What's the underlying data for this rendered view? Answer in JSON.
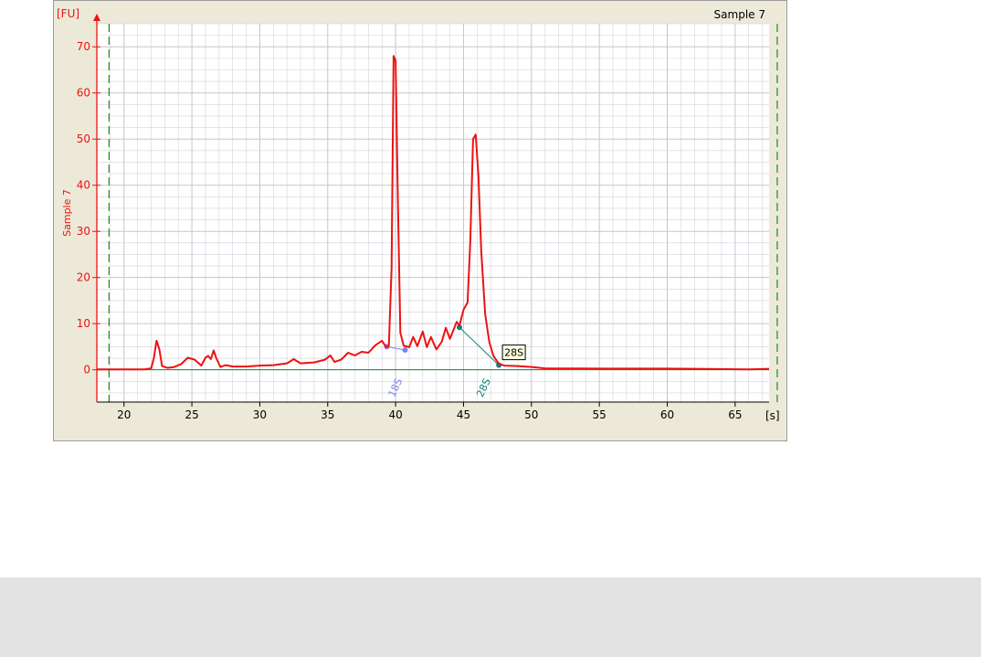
{
  "chart_data": {
    "type": "line",
    "title": "Sample 7",
    "ylabel": "Sample 7",
    "y_unit": "[FU]",
    "x_unit": "[s]",
    "xlim": [
      18,
      67.5
    ],
    "ylim": [
      -7,
      75
    ],
    "x_ticks": [
      20,
      25,
      30,
      35,
      40,
      45,
      50,
      55,
      60,
      65
    ],
    "y_ticks": [
      0,
      10,
      20,
      30,
      40,
      50,
      60,
      70
    ],
    "grid": true,
    "colors": {
      "trace": "#ee1111",
      "baseline": "#1e8a1e",
      "markers": "#1e8a1e",
      "axis": "#ee1111",
      "grid": "#c6c6d2",
      "plot_bg": "#ffffff",
      "peak_18s": "#8080ee",
      "peak_28s": "#138080"
    },
    "vertical_markers": [
      18.9,
      68.1
    ],
    "series": [
      {
        "name": "Sample 7",
        "points": [
          [
            18,
            0.1
          ],
          [
            20,
            0.1
          ],
          [
            21.5,
            0.1
          ],
          [
            22,
            0.3
          ],
          [
            22.2,
            2.5
          ],
          [
            22.4,
            6.3
          ],
          [
            22.6,
            4.5
          ],
          [
            22.8,
            0.8
          ],
          [
            23.2,
            0.4
          ],
          [
            23.7,
            0.6
          ],
          [
            24.2,
            1.2
          ],
          [
            24.7,
            2.6
          ],
          [
            25.2,
            2.2
          ],
          [
            25.7,
            0.9
          ],
          [
            26.0,
            2.6
          ],
          [
            26.2,
            3.0
          ],
          [
            26.4,
            2.3
          ],
          [
            26.6,
            4.2
          ],
          [
            26.8,
            2.5
          ],
          [
            27.1,
            0.6
          ],
          [
            27.5,
            1.0
          ],
          [
            28,
            0.7
          ],
          [
            29,
            0.7
          ],
          [
            30,
            0.9
          ],
          [
            31,
            1.0
          ],
          [
            32,
            1.4
          ],
          [
            32.5,
            2.3
          ],
          [
            33,
            1.4
          ],
          [
            34,
            1.6
          ],
          [
            34.8,
            2.2
          ],
          [
            35.2,
            3.1
          ],
          [
            35.5,
            1.7
          ],
          [
            36,
            2.2
          ],
          [
            36.5,
            3.7
          ],
          [
            37,
            3.1
          ],
          [
            37.5,
            3.9
          ],
          [
            38,
            3.7
          ],
          [
            38.5,
            5.3
          ],
          [
            39,
            6.3
          ],
          [
            39.3,
            4.9
          ],
          [
            39.5,
            5.1
          ],
          [
            39.7,
            22
          ],
          [
            39.85,
            68
          ],
          [
            40.0,
            67
          ],
          [
            40.15,
            40
          ],
          [
            40.35,
            8
          ],
          [
            40.6,
            5.2
          ],
          [
            41,
            4.9
          ],
          [
            41.3,
            7.1
          ],
          [
            41.6,
            5.1
          ],
          [
            42,
            8.3
          ],
          [
            42.3,
            4.9
          ],
          [
            42.6,
            7.1
          ],
          [
            43,
            4.4
          ],
          [
            43.4,
            6.1
          ],
          [
            43.7,
            9.1
          ],
          [
            44,
            6.7
          ],
          [
            44.3,
            8.9
          ],
          [
            44.5,
            10.4
          ],
          [
            44.7,
            9.6
          ],
          [
            45,
            13
          ],
          [
            45.3,
            14.6
          ],
          [
            45.5,
            28
          ],
          [
            45.7,
            50
          ],
          [
            45.9,
            51
          ],
          [
            46.1,
            42
          ],
          [
            46.3,
            26
          ],
          [
            46.6,
            12
          ],
          [
            46.9,
            6
          ],
          [
            47.2,
            3
          ],
          [
            47.6,
            1.3
          ],
          [
            48,
            0.9
          ],
          [
            49,
            0.8
          ],
          [
            50,
            0.6
          ],
          [
            51,
            0.3
          ],
          [
            55,
            0.25
          ],
          [
            60,
            0.25
          ],
          [
            62,
            0.2
          ],
          [
            66,
            0.1
          ],
          [
            67.5,
            0.2
          ]
        ]
      }
    ],
    "annotations": [
      {
        "label": "18S",
        "x": 40.2,
        "segment": [
          [
            39.35,
            5.0
          ],
          [
            40.7,
            4.3
          ]
        ]
      },
      {
        "label": "28S",
        "x": 46.7,
        "segment": [
          [
            44.7,
            9.2
          ],
          [
            47.6,
            1.0
          ]
        ],
        "callout": "28S"
      }
    ]
  }
}
